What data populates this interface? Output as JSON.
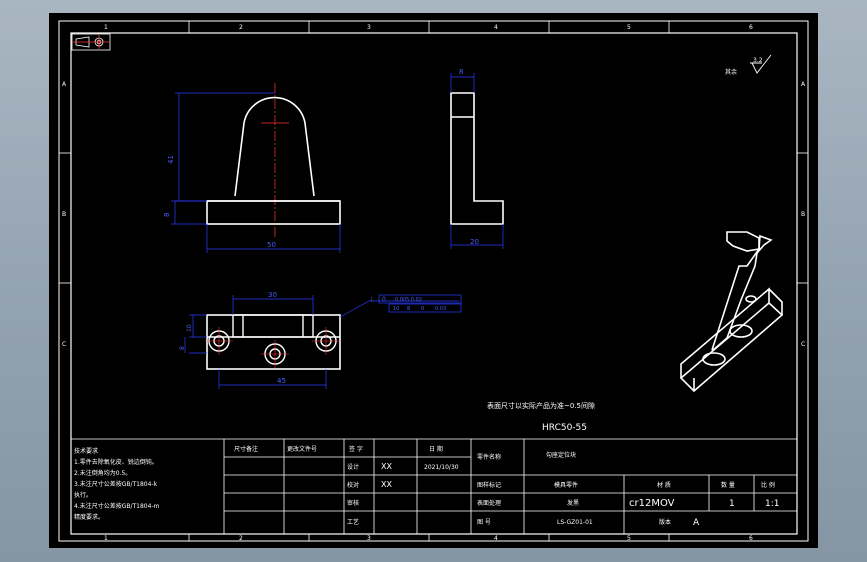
{
  "zone_numbers_top": [
    "1",
    "2",
    "3",
    "4",
    "5",
    "6"
  ],
  "zone_numbers_bottom": [
    "1",
    "2",
    "3",
    "4",
    "5",
    "6"
  ],
  "zone_letters": [
    "A",
    "B",
    "C"
  ],
  "dimensions": {
    "front_height": "41",
    "front_base_height": "8",
    "front_width": "50",
    "side_top_width": "8",
    "side_base_width": "20",
    "top_length": "30",
    "top_height_upper": "10",
    "top_height_lower": "8",
    "top_hole_spacing": "45"
  },
  "tolerance_frame": {
    "symbol": "⊥",
    "value": "0",
    "callout": "0.005 0.02",
    "sub_values": [
      "10",
      "8",
      "0",
      "0.03"
    ]
  },
  "surface_roughness": {
    "label": "其余",
    "value": "3.2"
  },
  "notes": {
    "title": "技术要求",
    "lines": [
      "1.零件去除氧化皮、锐边倒钝。",
      "2.未注倒角均为0.5。",
      "3.未注尺寸公差按GB/T1804-k",
      "执行。",
      "4.未注尺寸公差按GB/T1804-m",
      "精度要求。"
    ]
  },
  "annotation_note": "表面尺寸以实际产品为准~0.5间隙",
  "hardness": "HRC50-55",
  "title_block": {
    "col_headers": [
      "尺寸备注",
      "更改文件号",
      "签 字",
      "日 期"
    ],
    "row_labels": [
      "设计",
      "校对",
      "审核",
      "工艺"
    ],
    "designer": "XX",
    "checker": "XX",
    "date": "2021/10/30",
    "company_label": "零件名称",
    "part_name": "勾座定位块",
    "drawing_type_label": "图样标记",
    "drawing_type": "模具零件",
    "process_label": "表面处理",
    "process": "发黑",
    "drawing_no_label": "图 号",
    "drawing_no": "LS-GZ01-01",
    "material_label": "材 质",
    "material": "cr12MOV",
    "qty_label": "数 量",
    "qty": "1",
    "scale_label": "比 例",
    "scale": "1:1",
    "version_label": "版本",
    "version": "A"
  }
}
